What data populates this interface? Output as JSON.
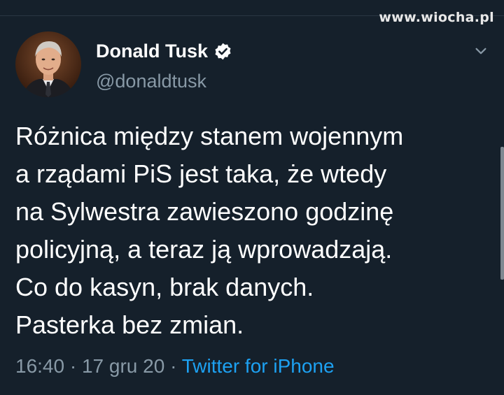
{
  "watermark": "www.wiocha.pl",
  "author": {
    "display_name": "Donald Tusk",
    "handle": "@donaldtusk",
    "verified_icon": "verified-badge-icon",
    "avatar_icon": "profile-photo"
  },
  "menu_icon": "chevron-down-icon",
  "tweet": {
    "lines": [
      "Różnica między stanem wojennym",
      "a rządami PiS jest taka, że wtedy",
      "na Sylwestra zawieszono godzinę",
      "policyjną, a teraz ją wprowadzają.",
      "Co do kasyn, brak danych.",
      "Pasterka bez zmian."
    ]
  },
  "meta": {
    "time": "16:40",
    "separator": " · ",
    "date": "17 gru 20",
    "source": "Twitter for iPhone"
  },
  "colors": {
    "background": "#15202b",
    "text_primary": "#ffffff",
    "text_secondary": "#8899a6",
    "link": "#1da1f2"
  }
}
